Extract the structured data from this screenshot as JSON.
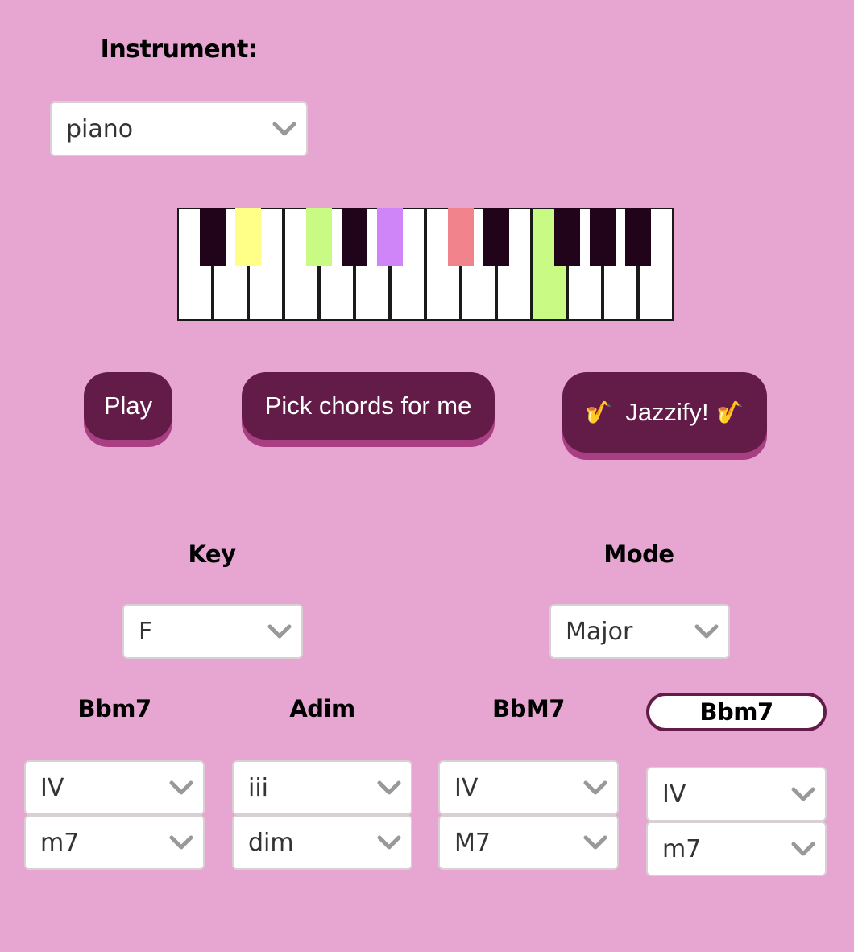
{
  "instrument": {
    "label": "Instrument:",
    "selected": "piano"
  },
  "piano": {
    "white_key_colors": [
      "#ffffff",
      "#ffffff",
      "#ffffff",
      "#ffffff",
      "#ffffff",
      "#ffffff",
      "#ffffff",
      "#ffffff",
      "#ffffff",
      "#ffffff",
      "#c8fa84",
      "#ffffff",
      "#ffffff",
      "#ffffff"
    ],
    "black_key_colors": [
      "#22041a",
      "#ffff88",
      "#c8fa84",
      "#22041a",
      "#cf85f7",
      "#f0838c",
      "#22041a",
      "#22041a",
      "#22041a",
      "#22041a"
    ]
  },
  "buttons": {
    "play": "Play",
    "pick": "Pick chords for me",
    "jazzify_text": "Jazzify!",
    "jazzify_icon": "🎷"
  },
  "key": {
    "label": "Key",
    "selected": "F"
  },
  "mode": {
    "label": "Mode",
    "selected": "Major"
  },
  "chords": [
    {
      "name": "Bbm7",
      "degree": "IV",
      "quality": "m7",
      "active": false
    },
    {
      "name": "Adim",
      "degree": "iii",
      "quality": "dim",
      "active": false
    },
    {
      "name": "BbM7",
      "degree": "IV",
      "quality": "M7",
      "active": false
    },
    {
      "name": "Bbm7",
      "degree": "IV",
      "quality": "m7",
      "active": true
    }
  ],
  "colors": {
    "background": "#e6a6d1",
    "button": "#631c47",
    "button_shadow": "#a83f83"
  }
}
